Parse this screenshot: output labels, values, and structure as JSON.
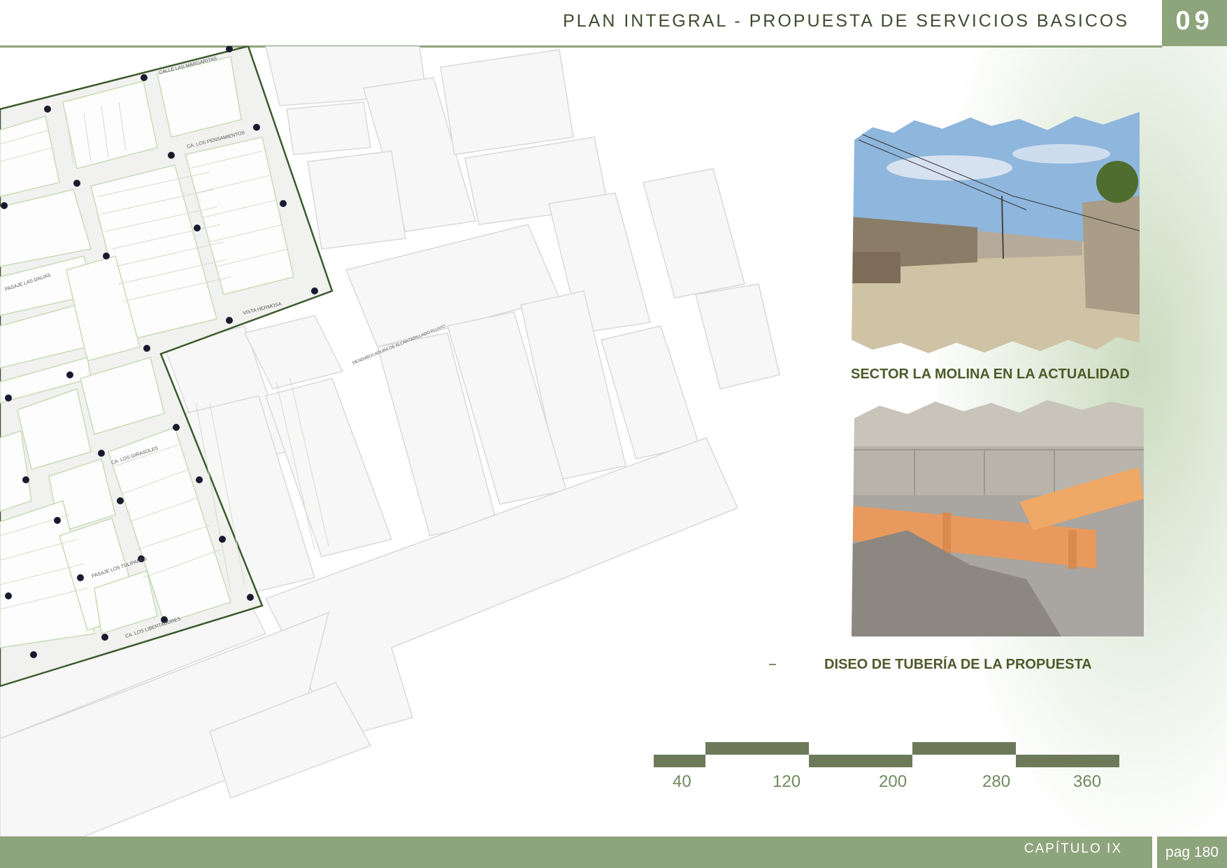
{
  "header": {
    "title": "PLAN INTEGRAL - PROPUESTA DE SERVICIOS BASICOS",
    "number": "09"
  },
  "map": {
    "street_labels": [
      "CALLE LAS MARGARITAS",
      "CA. LOS PENSAMIENTOS",
      "CA. LOS GIRASOLES",
      "CA. LOS LIBERTADORES",
      "VISTA HERMOSA",
      "PASAJE LAS DALIAS",
      "PASAJE LOS TULIPANES"
    ],
    "annotation": "DESEMBOCADURA DE ALCANTARILLADO PLUVIO"
  },
  "photos": [
    {
      "caption": "SECTOR LA MOLINA EN LA ACTUALIDAD"
    },
    {
      "caption": "DISEO DE TUBERÍA DE LA PROPUESTA"
    }
  ],
  "scale_bar": {
    "labels": [
      "40",
      "120",
      "200",
      "280",
      "360"
    ]
  },
  "footer": {
    "chapter": "CAPÍTULO IX",
    "page": "pag 180"
  },
  "colors": {
    "accent": "#8ea47c",
    "caption": "#4d5a2a",
    "pipe": "#e89a5e"
  }
}
